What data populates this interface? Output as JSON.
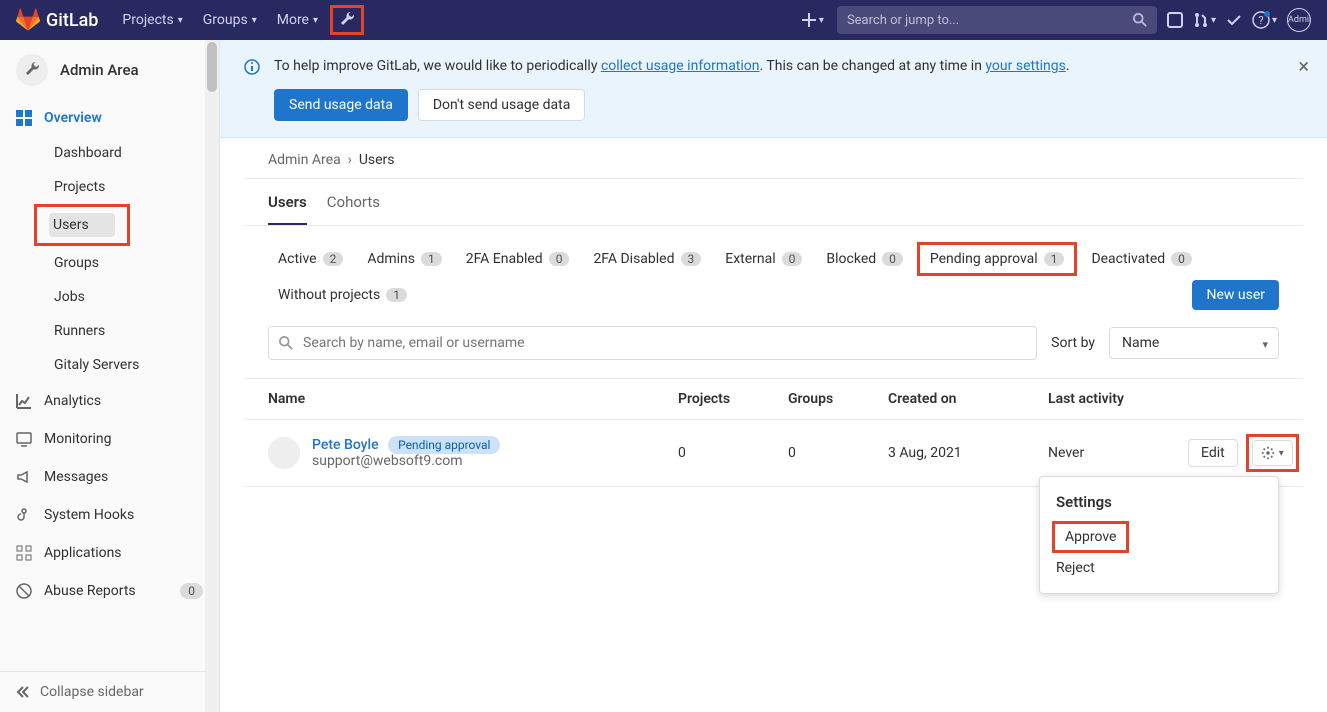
{
  "brand": "GitLab",
  "nav": {
    "projects": "Projects",
    "groups": "Groups",
    "more": "More",
    "search_placeholder": "Search or jump to...",
    "user": "Administrator"
  },
  "sidebar": {
    "title": "Admin Area",
    "overview": "Overview",
    "items": {
      "dashboard": "Dashboard",
      "projects": "Projects",
      "users": "Users",
      "groups": "Groups",
      "jobs": "Jobs",
      "runners": "Runners",
      "gitaly": "Gitaly Servers"
    },
    "analytics": "Analytics",
    "monitoring": "Monitoring",
    "messages": "Messages",
    "hooks": "System Hooks",
    "applications": "Applications",
    "abuse": "Abuse Reports",
    "abuse_count": "0",
    "collapse": "Collapse sidebar"
  },
  "banner": {
    "text_a": "To help improve GitLab, we would like to periodically ",
    "link_a": "collect usage information",
    "text_b": ". This can be changed at any time in ",
    "link_b": "your settings",
    "text_c": ".",
    "send": "Send usage data",
    "dont": "Don't send usage data"
  },
  "crumbs": {
    "a": "Admin Area",
    "b": "Users"
  },
  "tabs": {
    "users": "Users",
    "cohorts": "Cohorts"
  },
  "filters": {
    "active": {
      "label": "Active",
      "count": "2"
    },
    "admins": {
      "label": "Admins",
      "count": "1"
    },
    "tfa_en": {
      "label": "2FA Enabled",
      "count": "0"
    },
    "tfa_dis": {
      "label": "2FA Disabled",
      "count": "3"
    },
    "external": {
      "label": "External",
      "count": "0"
    },
    "blocked": {
      "label": "Blocked",
      "count": "0"
    },
    "pending": {
      "label": "Pending approval",
      "count": "1"
    },
    "deact": {
      "label": "Deactivated",
      "count": "0"
    },
    "noproj": {
      "label": "Without projects",
      "count": "1"
    }
  },
  "new_user": "New user",
  "search": {
    "placeholder": "Search by name, email or username"
  },
  "sort": {
    "label": "Sort by",
    "value": "Name"
  },
  "table": {
    "headers": {
      "name": "Name",
      "projects": "Projects",
      "groups": "Groups",
      "created": "Created on",
      "last": "Last activity"
    },
    "row": {
      "name": "Pete Boyle",
      "badge": "Pending approval",
      "email": "support@websoft9.com",
      "projects": "0",
      "groups": "0",
      "created": "3 Aug, 2021",
      "last": "Never",
      "edit": "Edit"
    }
  },
  "dropdown": {
    "header": "Settings",
    "approve": "Approve",
    "reject": "Reject"
  }
}
